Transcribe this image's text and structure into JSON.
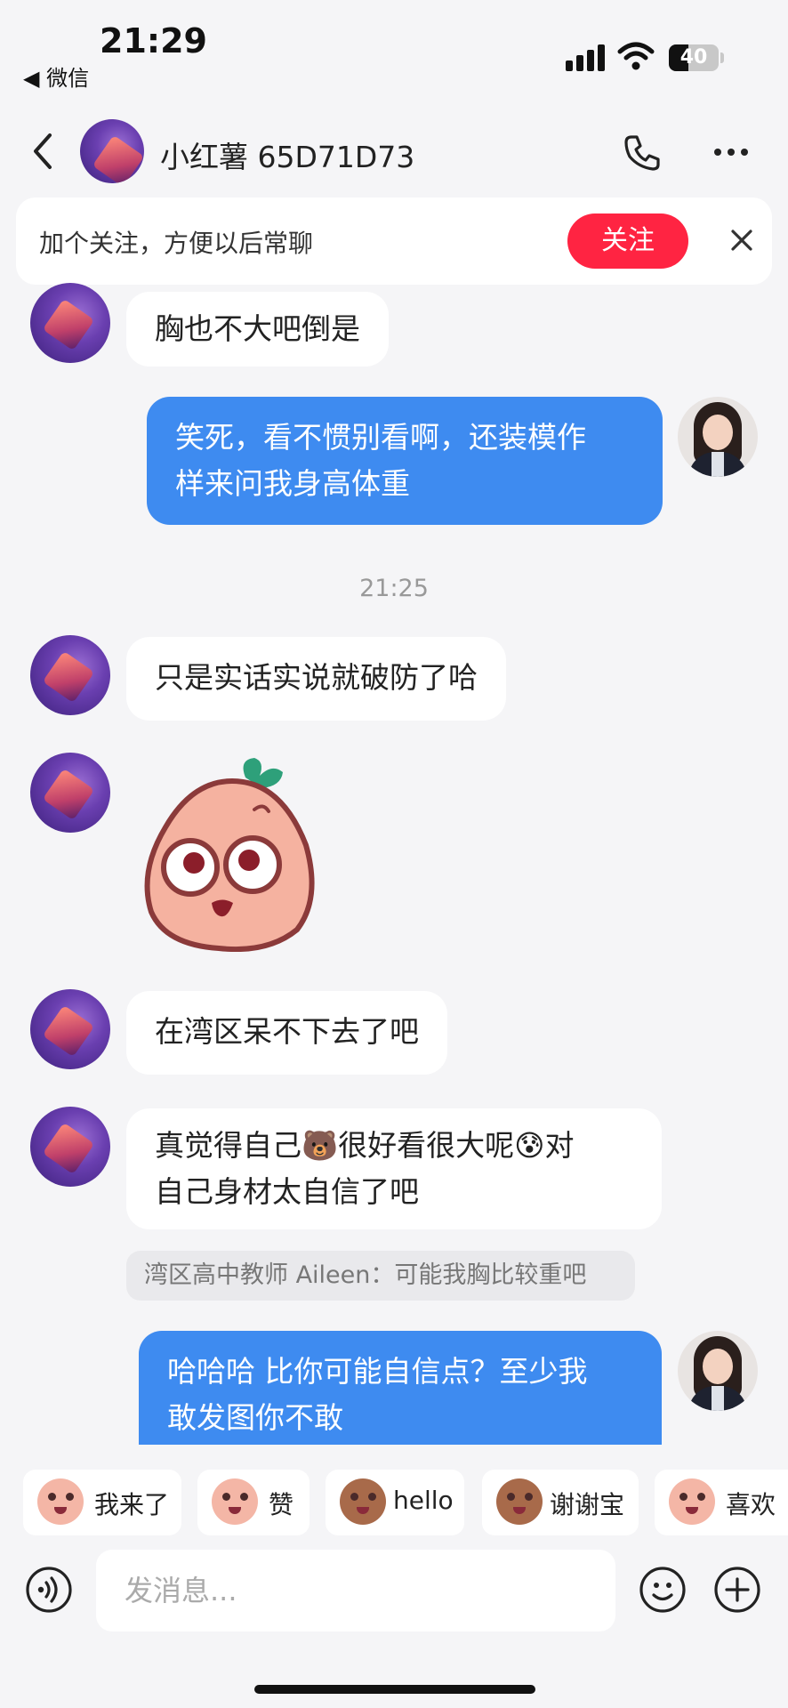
{
  "status_bar": {
    "time": "21:29",
    "back_app": "◀ 微信",
    "battery": "40",
    "battery_level_percent": 40
  },
  "header": {
    "title": "小红薯 65D71D73"
  },
  "follow_banner": {
    "text": "加个关注，方便以后常聊",
    "button_label": "关注"
  },
  "messages": [
    {
      "from": "other",
      "text": "胸也不大吧倒是"
    },
    {
      "from": "me",
      "lines": [
        "笑死，看不惯别看啊，还装模作",
        "样来问我身高体重"
      ]
    },
    {
      "from": "other",
      "text": "只是实话实说就破防了哈"
    },
    {
      "from": "other",
      "sticker": "sweet-potato-surprised-sticker"
    },
    {
      "from": "other",
      "text": "在湾区呆不下去了吧"
    },
    {
      "from": "other",
      "line1_a": "真觉得自己",
      "line1_b": "很好看很大呢",
      "line1_c": "对",
      "line2": "自己身材太自信了吧"
    },
    {
      "from": "me",
      "lines": [
        "哈哈哈 比你可能自信点？至少我",
        "敢发图你不敢"
      ]
    }
  ],
  "timestamp": "21:25",
  "quote": "湾区高中教师 Aileen：可能我胸比较重吧",
  "quick_replies": [
    "我来了",
    "赞",
    "hello",
    "谢谢宝",
    "喜欢"
  ],
  "input": {
    "placeholder": "发消息..."
  },
  "colors": {
    "accent_red": "#ff2442",
    "outgoing_bubble": "#3e8bf0",
    "incoming_bubble": "#ffffff",
    "background": "#f5f5f7"
  },
  "icons": [
    "voice-icon",
    "emoji-icon",
    "plus-icon",
    "phone-icon",
    "more-icon",
    "close-icon",
    "back-icon",
    "wifi-icon",
    "signal-icon",
    "battery-icon"
  ]
}
